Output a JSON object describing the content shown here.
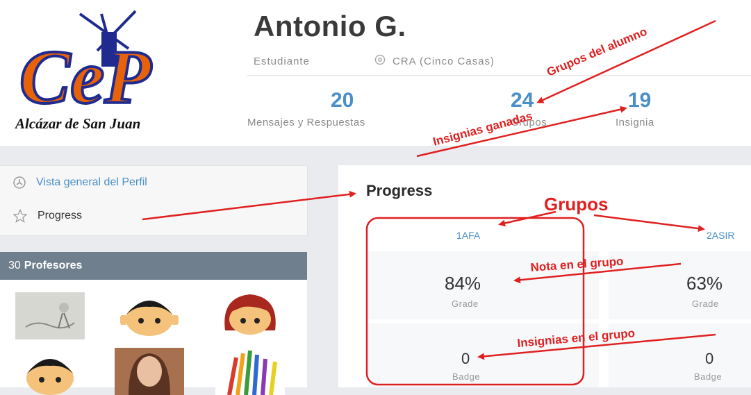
{
  "header": {
    "logo_text": "CeP",
    "logo_subtitle": "Alcázar de San Juan",
    "name": "Antonio G.",
    "role": "Estudiante",
    "location": "CRA (Cinco Casas)",
    "stats": [
      {
        "value": "20",
        "label": "Mensajes y Respuestas"
      },
      {
        "value": "24",
        "label": "Grupos"
      },
      {
        "value": "19",
        "label": "Insignia"
      }
    ]
  },
  "sidebar": {
    "items": [
      {
        "label": "Vista general del Perfil",
        "icon": "clock-icon"
      },
      {
        "label": "Progress",
        "icon": "star-icon"
      }
    ],
    "teachers": {
      "count": "30",
      "title": "Profesores"
    }
  },
  "main": {
    "title": "Progress",
    "groups": [
      {
        "name": "1AFA",
        "grade": "84%",
        "grade_label": "Grade",
        "badge": "0",
        "badge_label": "Badge"
      },
      {
        "name": "2ASIR",
        "grade": "63%",
        "grade_label": "Grade",
        "badge": "0",
        "badge_label": "Badge"
      }
    ]
  },
  "annotations": {
    "grupos_alumno": "Grupos del alumno",
    "insignias_ganadas": "Insignias ganadas",
    "grupos": "Grupos",
    "nota_grupo": "Nota en el grupo",
    "insignias_grupo": "Insignias en el grupo"
  },
  "colors": {
    "accent": "#4a8fc9",
    "annotation": "#e02020",
    "logo_orange": "#e8620a",
    "logo_blue": "#1f2b8f"
  }
}
